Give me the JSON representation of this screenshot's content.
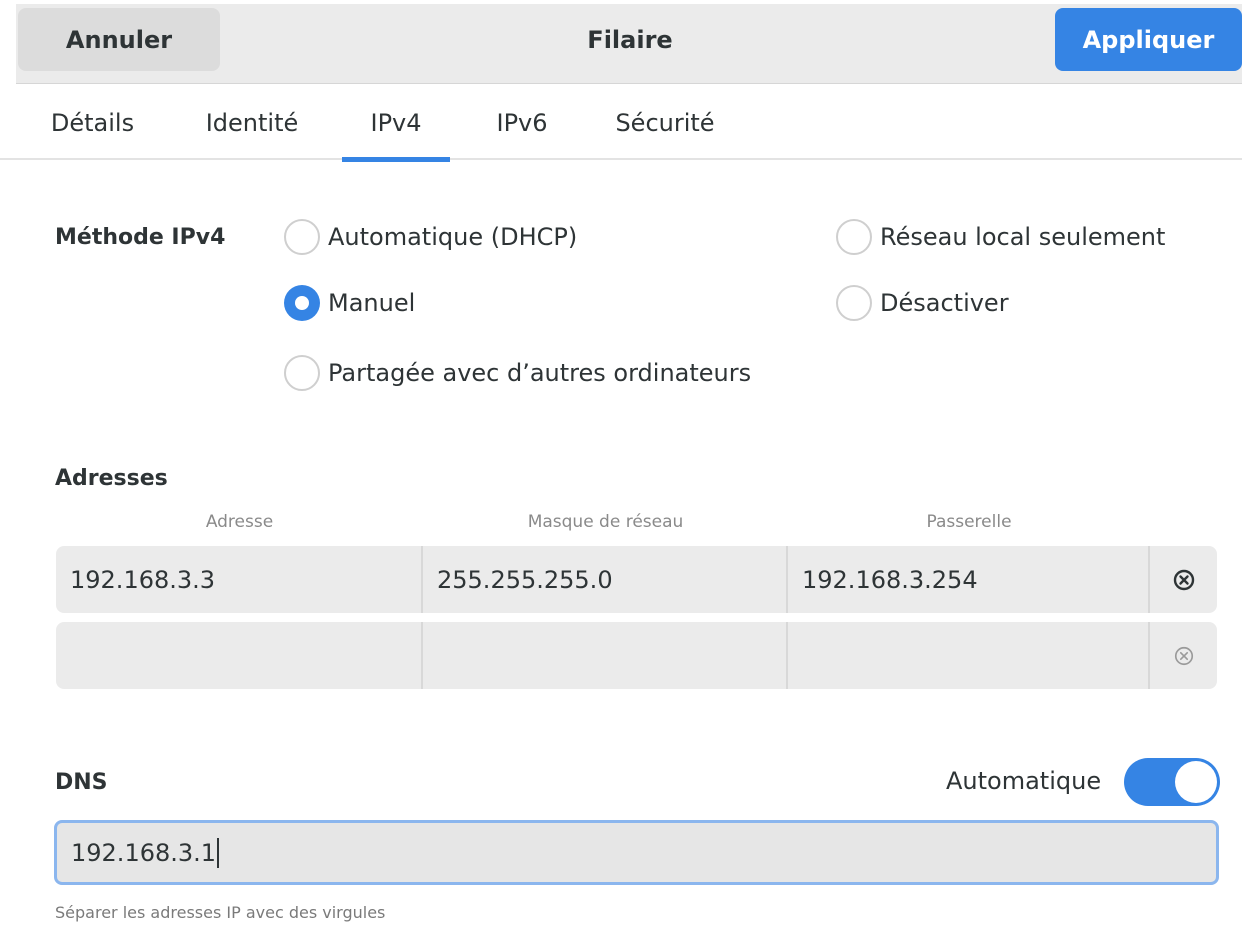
{
  "header": {
    "cancel_label": "Annuler",
    "title": "Filaire",
    "apply_label": "Appliquer"
  },
  "tabs": [
    {
      "label": "Détails",
      "active": false
    },
    {
      "label": "Identité",
      "active": false
    },
    {
      "label": "IPv4",
      "active": true
    },
    {
      "label": "IPv6",
      "active": false
    },
    {
      "label": "Sécurité",
      "active": false
    }
  ],
  "method": {
    "label": "Méthode IPv4",
    "options": [
      {
        "label": "Automatique (DHCP)",
        "checked": false
      },
      {
        "label": "Réseau local seulement",
        "checked": false
      },
      {
        "label": "Manuel",
        "checked": true
      },
      {
        "label": "Désactiver",
        "checked": false
      },
      {
        "label": "Partagée avec d’autres ordinateurs",
        "checked": false
      }
    ]
  },
  "addresses": {
    "title": "Adresses",
    "columns": [
      "Adresse",
      "Masque de réseau",
      "Passerelle"
    ],
    "rows": [
      {
        "address": "192.168.3.3",
        "netmask": "255.255.255.0",
        "gateway": "192.168.3.254"
      },
      {
        "address": "",
        "netmask": "",
        "gateway": ""
      }
    ]
  },
  "dns": {
    "title": "DNS",
    "auto_label": "Automatique",
    "auto_enabled": true,
    "value": "192.168.3.1",
    "hint": "Séparer les adresses IP avec des virgules"
  },
  "colors": {
    "accent": "#3584e4",
    "header_bg": "#ebebeb",
    "field_bg": "#ebebeb"
  }
}
